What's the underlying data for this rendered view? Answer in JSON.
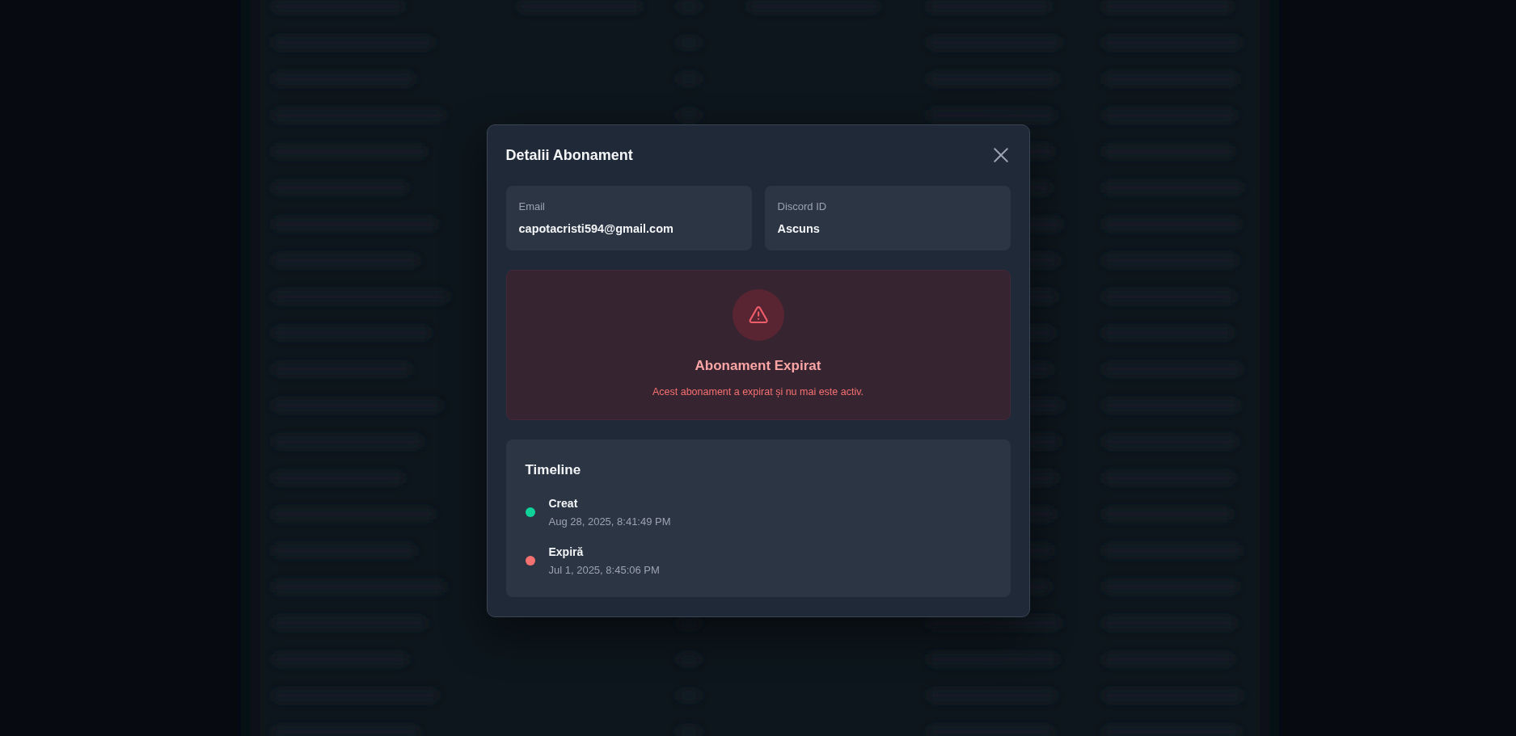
{
  "modal": {
    "title": "Detalii Abonament",
    "info_cards": [
      {
        "label": "Email",
        "value": "capotacristi594@gmail.com"
      },
      {
        "label": "Discord ID",
        "value": "Ascuns"
      }
    ],
    "status_alert": {
      "kind": "expired",
      "title": "Abonament Expirat",
      "message": "Acest abonament a expirat și nu mai este activ."
    },
    "timeline": {
      "title": "Timeline",
      "events": [
        {
          "label": "Creat",
          "time": "Aug 28, 2025, 8:41:49 PM",
          "color": "#10d39a"
        },
        {
          "label": "Expiră",
          "time": "Jul 1, 2025, 8:45:06 PM",
          "color": "#f87171"
        }
      ]
    }
  }
}
